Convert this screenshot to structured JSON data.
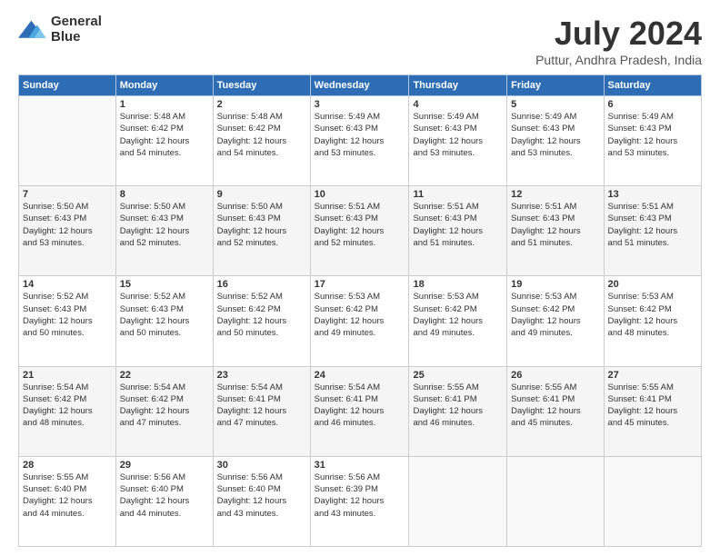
{
  "header": {
    "logo_line1": "General",
    "logo_line2": "Blue",
    "month": "July 2024",
    "location": "Puttur, Andhra Pradesh, India"
  },
  "days_of_week": [
    "Sunday",
    "Monday",
    "Tuesday",
    "Wednesday",
    "Thursday",
    "Friday",
    "Saturday"
  ],
  "weeks": [
    [
      {
        "day": "",
        "detail": ""
      },
      {
        "day": "1",
        "detail": "Sunrise: 5:48 AM\nSunset: 6:42 PM\nDaylight: 12 hours\nand 54 minutes."
      },
      {
        "day": "2",
        "detail": "Sunrise: 5:48 AM\nSunset: 6:42 PM\nDaylight: 12 hours\nand 54 minutes."
      },
      {
        "day": "3",
        "detail": "Sunrise: 5:49 AM\nSunset: 6:43 PM\nDaylight: 12 hours\nand 53 minutes."
      },
      {
        "day": "4",
        "detail": "Sunrise: 5:49 AM\nSunset: 6:43 PM\nDaylight: 12 hours\nand 53 minutes."
      },
      {
        "day": "5",
        "detail": "Sunrise: 5:49 AM\nSunset: 6:43 PM\nDaylight: 12 hours\nand 53 minutes."
      },
      {
        "day": "6",
        "detail": "Sunrise: 5:49 AM\nSunset: 6:43 PM\nDaylight: 12 hours\nand 53 minutes."
      }
    ],
    [
      {
        "day": "7",
        "detail": "Sunrise: 5:50 AM\nSunset: 6:43 PM\nDaylight: 12 hours\nand 53 minutes."
      },
      {
        "day": "8",
        "detail": "Sunrise: 5:50 AM\nSunset: 6:43 PM\nDaylight: 12 hours\nand 52 minutes."
      },
      {
        "day": "9",
        "detail": "Sunrise: 5:50 AM\nSunset: 6:43 PM\nDaylight: 12 hours\nand 52 minutes."
      },
      {
        "day": "10",
        "detail": "Sunrise: 5:51 AM\nSunset: 6:43 PM\nDaylight: 12 hours\nand 52 minutes."
      },
      {
        "day": "11",
        "detail": "Sunrise: 5:51 AM\nSunset: 6:43 PM\nDaylight: 12 hours\nand 51 minutes."
      },
      {
        "day": "12",
        "detail": "Sunrise: 5:51 AM\nSunset: 6:43 PM\nDaylight: 12 hours\nand 51 minutes."
      },
      {
        "day": "13",
        "detail": "Sunrise: 5:51 AM\nSunset: 6:43 PM\nDaylight: 12 hours\nand 51 minutes."
      }
    ],
    [
      {
        "day": "14",
        "detail": "Sunrise: 5:52 AM\nSunset: 6:43 PM\nDaylight: 12 hours\nand 50 minutes."
      },
      {
        "day": "15",
        "detail": "Sunrise: 5:52 AM\nSunset: 6:43 PM\nDaylight: 12 hours\nand 50 minutes."
      },
      {
        "day": "16",
        "detail": "Sunrise: 5:52 AM\nSunset: 6:42 PM\nDaylight: 12 hours\nand 50 minutes."
      },
      {
        "day": "17",
        "detail": "Sunrise: 5:53 AM\nSunset: 6:42 PM\nDaylight: 12 hours\nand 49 minutes."
      },
      {
        "day": "18",
        "detail": "Sunrise: 5:53 AM\nSunset: 6:42 PM\nDaylight: 12 hours\nand 49 minutes."
      },
      {
        "day": "19",
        "detail": "Sunrise: 5:53 AM\nSunset: 6:42 PM\nDaylight: 12 hours\nand 49 minutes."
      },
      {
        "day": "20",
        "detail": "Sunrise: 5:53 AM\nSunset: 6:42 PM\nDaylight: 12 hours\nand 48 minutes."
      }
    ],
    [
      {
        "day": "21",
        "detail": "Sunrise: 5:54 AM\nSunset: 6:42 PM\nDaylight: 12 hours\nand 48 minutes."
      },
      {
        "day": "22",
        "detail": "Sunrise: 5:54 AM\nSunset: 6:42 PM\nDaylight: 12 hours\nand 47 minutes."
      },
      {
        "day": "23",
        "detail": "Sunrise: 5:54 AM\nSunset: 6:41 PM\nDaylight: 12 hours\nand 47 minutes."
      },
      {
        "day": "24",
        "detail": "Sunrise: 5:54 AM\nSunset: 6:41 PM\nDaylight: 12 hours\nand 46 minutes."
      },
      {
        "day": "25",
        "detail": "Sunrise: 5:55 AM\nSunset: 6:41 PM\nDaylight: 12 hours\nand 46 minutes."
      },
      {
        "day": "26",
        "detail": "Sunrise: 5:55 AM\nSunset: 6:41 PM\nDaylight: 12 hours\nand 45 minutes."
      },
      {
        "day": "27",
        "detail": "Sunrise: 5:55 AM\nSunset: 6:41 PM\nDaylight: 12 hours\nand 45 minutes."
      }
    ],
    [
      {
        "day": "28",
        "detail": "Sunrise: 5:55 AM\nSunset: 6:40 PM\nDaylight: 12 hours\nand 44 minutes."
      },
      {
        "day": "29",
        "detail": "Sunrise: 5:56 AM\nSunset: 6:40 PM\nDaylight: 12 hours\nand 44 minutes."
      },
      {
        "day": "30",
        "detail": "Sunrise: 5:56 AM\nSunset: 6:40 PM\nDaylight: 12 hours\nand 43 minutes."
      },
      {
        "day": "31",
        "detail": "Sunrise: 5:56 AM\nSunset: 6:39 PM\nDaylight: 12 hours\nand 43 minutes."
      },
      {
        "day": "",
        "detail": ""
      },
      {
        "day": "",
        "detail": ""
      },
      {
        "day": "",
        "detail": ""
      }
    ]
  ]
}
